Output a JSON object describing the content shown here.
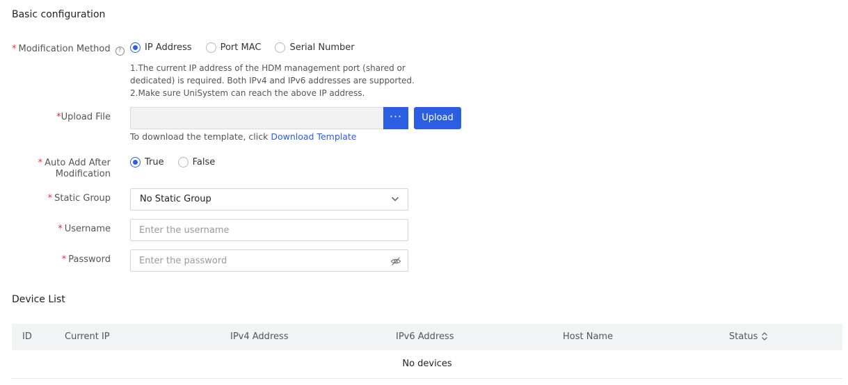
{
  "sections": {
    "basic_title": "Basic configuration",
    "device_title": "Device List"
  },
  "form": {
    "method": {
      "label": "Modification Method",
      "options": [
        "IP Address",
        "Port MAC",
        "Serial Number"
      ],
      "selected": "IP Address",
      "hint_lines": [
        "1.The current IP address of the HDM management port (shared or",
        "dedicated) is required. Both IPv4 and IPv6 addresses are supported.",
        "2.Make sure UniSystem can reach the above IP address."
      ]
    },
    "upload": {
      "label": "Upload File",
      "browse_label": "···",
      "button_label": "Upload",
      "hint": "To download the template, click ",
      "link": "Download Template"
    },
    "auto_add": {
      "label_line1": "Auto Add After",
      "label_line2": "Modification",
      "options": [
        "True",
        "False"
      ],
      "selected": "True"
    },
    "static_group": {
      "label": "Static Group",
      "value": "No Static Group"
    },
    "username": {
      "label": "Username",
      "placeholder": "Enter the username"
    },
    "password": {
      "label": "Password",
      "placeholder": "Enter the password"
    },
    "required_mark": "*",
    "help_glyph": "?"
  },
  "table": {
    "columns": [
      "ID",
      "Current IP",
      "IPv4 Address",
      "IPv6 Address",
      "Host Name",
      "Status"
    ],
    "empty_text": "No devices"
  },
  "colors": {
    "accent": "#2b5ee1",
    "required": "#e0323c"
  }
}
